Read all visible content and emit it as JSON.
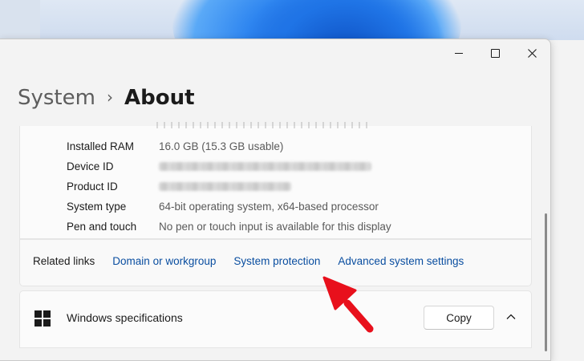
{
  "window": {
    "controls": {
      "minimize": "minimize",
      "maximize": "maximize",
      "close": "close"
    }
  },
  "breadcrumb": {
    "parent": "System",
    "separator": "›",
    "current": "About"
  },
  "device_specs": {
    "rows": [
      {
        "label": "Installed RAM",
        "value": "16.0 GB (15.3 GB usable)"
      },
      {
        "label": "Device ID",
        "value": "",
        "blurred": true
      },
      {
        "label": "Product ID",
        "value": "",
        "blurred": true
      },
      {
        "label": "System type",
        "value": "64-bit operating system, x64-based processor"
      },
      {
        "label": "Pen and touch",
        "value": "No pen or touch input is available for this display"
      }
    ]
  },
  "related_links": {
    "title": "Related links",
    "links": [
      "Domain or workgroup",
      "System protection",
      "Advanced system settings"
    ]
  },
  "windows_specs": {
    "title": "Windows specifications",
    "copy_label": "Copy",
    "icon": "windows-logo-icon",
    "expand_icon": "chevron-up-icon"
  },
  "annotation": {
    "color": "#e8101c",
    "icon": "red-arrow-icon"
  },
  "colors": {
    "link": "#0a4ea0",
    "window_bg": "#f3f3f3",
    "card_bg": "#fbfbfb"
  }
}
